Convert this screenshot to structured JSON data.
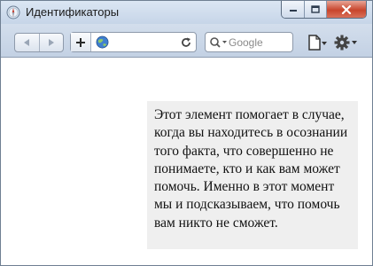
{
  "window": {
    "title": "Идентификаторы"
  },
  "toolbar": {
    "back_icon": "back-arrow-icon",
    "forward_icon": "forward-arrow-icon",
    "add_icon": "plus-icon",
    "url": {
      "value": ""
    },
    "search": {
      "placeholder": "Google"
    }
  },
  "page": {
    "paragraph": "Этот элемент помогает в случае, когда вы находитесь в осознании того факта, что совершенно не понимаете, кто и как вам может помочь. Именно в этот момент мы и подсказываем, что помочь вам никто не сможет."
  },
  "colors": {
    "box_background": "#efefef",
    "close_button": "#c8452c",
    "chrome": "#c6d5e8"
  }
}
